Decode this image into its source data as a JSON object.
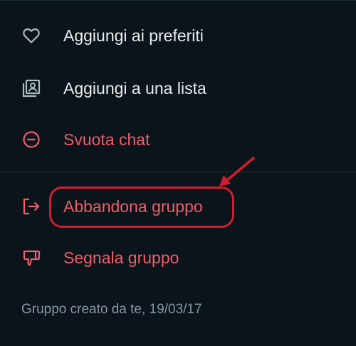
{
  "menu": {
    "items": [
      {
        "id": "favorites",
        "label": "Aggiungi ai preferiti",
        "icon": "heart-outline-icon",
        "style": "light"
      },
      {
        "id": "add-list",
        "label": "Aggiungi a una lista",
        "icon": "contact-list-icon",
        "style": "light"
      },
      {
        "id": "clear-chat",
        "label": "Svuota chat",
        "icon": "minus-circle-icon",
        "style": "danger"
      },
      {
        "id": "leave-group",
        "label": "Abbandona gruppo",
        "icon": "exit-icon",
        "style": "danger"
      },
      {
        "id": "report-group",
        "label": "Segnala gruppo",
        "icon": "thumbs-down-icon",
        "style": "danger"
      }
    ]
  },
  "footer": {
    "created_note": "Gruppo creato da te, 19/03/17"
  },
  "colors": {
    "background": "#0b141a",
    "text_light": "#e9edef",
    "danger": "#ef5e6a",
    "muted": "#8696a0",
    "annotation": "#d31d2f"
  }
}
